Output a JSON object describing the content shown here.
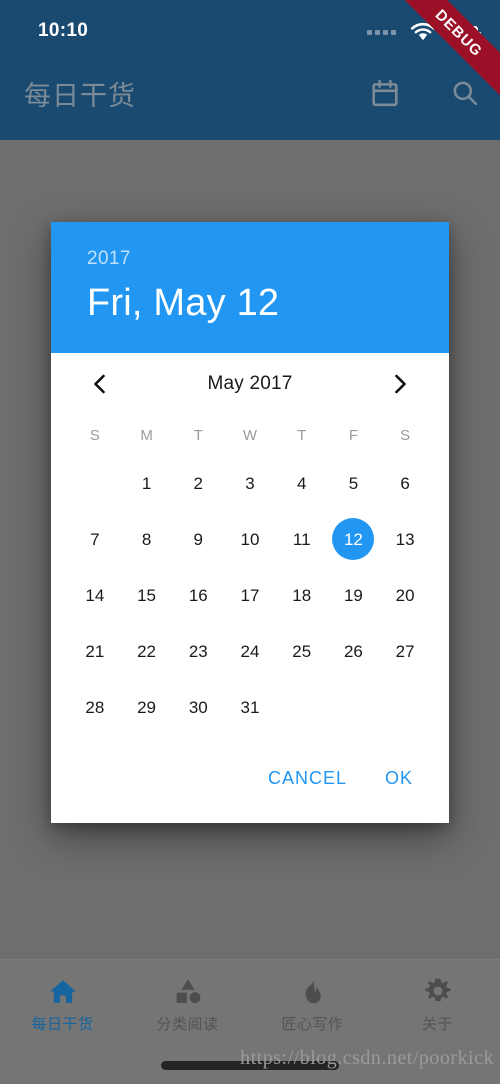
{
  "status_bar": {
    "time": "10:10",
    "signal_icon": "signal-dots-icon",
    "wifi_icon": "wifi-icon",
    "battery_icon": "battery-icon"
  },
  "debug_banner": {
    "label": "DEBUG"
  },
  "app_bar": {
    "title": "每日干货",
    "calendar_icon": "calendar-icon",
    "search_icon": "search-icon",
    "background_color": "#1b4a71"
  },
  "dialog": {
    "year": "2017",
    "date_headline": "Fri, May 12",
    "accent_color": "#2196f3",
    "month_label": "May 2017",
    "prev_icon": "chevron-left-icon",
    "next_icon": "chevron-right-icon",
    "weekdays": [
      "S",
      "M",
      "T",
      "W",
      "T",
      "F",
      "S"
    ],
    "leading_blanks": 1,
    "days": [
      1,
      2,
      3,
      4,
      5,
      6,
      7,
      8,
      9,
      10,
      11,
      12,
      13,
      14,
      15,
      16,
      17,
      18,
      19,
      20,
      21,
      22,
      23,
      24,
      25,
      26,
      27,
      28,
      29,
      30,
      31
    ],
    "selected_day": 12,
    "cancel_label": "CANCEL",
    "ok_label": "OK"
  },
  "bottom_nav": {
    "items": [
      {
        "label": "每日干货",
        "icon": "home-icon",
        "active": true
      },
      {
        "label": "分类阅读",
        "icon": "category-shapes-icon",
        "active": false
      },
      {
        "label": "匠心写作",
        "icon": "flame-icon",
        "active": false
      },
      {
        "label": "关于",
        "icon": "gear-icon",
        "active": false
      }
    ],
    "active_color": "#1565a0"
  },
  "watermark": {
    "text": "https://blog.csdn.net/poorkick"
  }
}
